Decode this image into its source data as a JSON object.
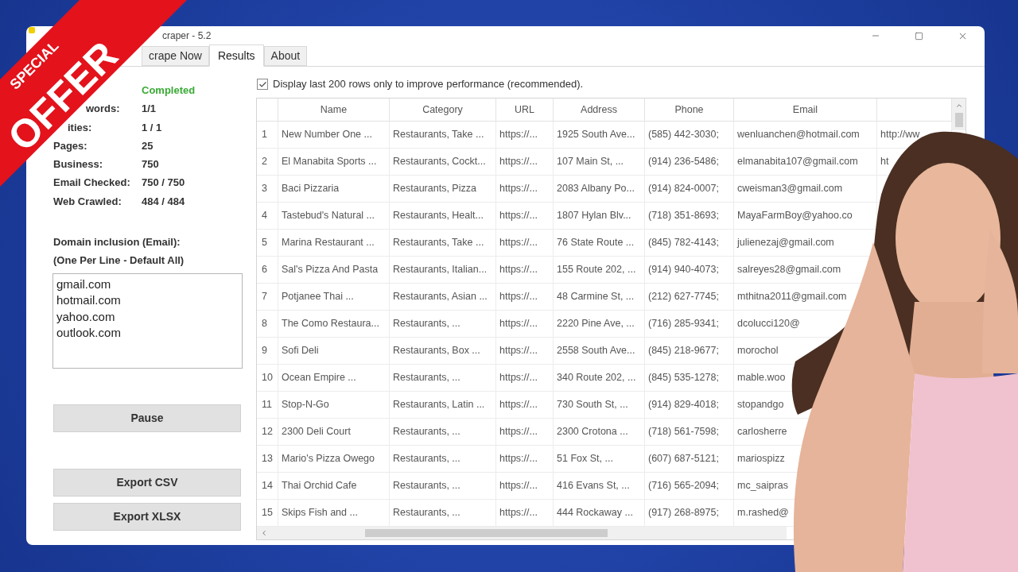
{
  "ribbon": {
    "lines": [
      {
        "text": "SPECIAL",
        "kind": "small"
      },
      {
        "text": "OFFER",
        "kind": "large"
      }
    ]
  },
  "window": {
    "title": "craper - 5.2"
  },
  "tabs": [
    {
      "label": "crape Now",
      "selected": false
    },
    {
      "label": "Results",
      "selected": true
    },
    {
      "label": "About",
      "selected": false
    }
  ],
  "stats": [
    {
      "kind": "status",
      "value": "Completed"
    },
    {
      "kind": "count",
      "label": "words:",
      "value": "1/1"
    },
    {
      "kind": "count",
      "label": "ities:",
      "value": "1 / 1"
    },
    {
      "kind": "count",
      "label": "Pages:",
      "value": "25"
    },
    {
      "kind": "count",
      "label": "Business:",
      "value": "750"
    },
    {
      "kind": "count",
      "label": "Email Checked:",
      "value": "750 / 750"
    },
    {
      "kind": "count",
      "label": "Web Crawled:",
      "value": "484 / 484"
    }
  ],
  "domain_inclusion": {
    "label": "Domain inclusion (Email):",
    "note": "(One Per Line - Default All)",
    "value": [
      "gmail.com",
      "hotmail.com",
      "yahoo.com",
      "outlook.com"
    ]
  },
  "control_buttons": [
    "Pause"
  ],
  "export_buttons": [
    "Export CSV",
    "Export XLSX"
  ],
  "display_option": {
    "label": "Display last 200 rows only to improve performance (recommended).",
    "checked": true
  },
  "table": {
    "columns": [
      "Name",
      "Category",
      "URL",
      "Address",
      "Phone",
      "Email"
    ],
    "rows": [
      {
        "number": "1",
        "cells": [
          "New Number One ...",
          "Restaurants, Take ...",
          "https://...",
          "1925 South Ave...",
          "(585) 442-3030;",
          "wenluanchen@hotmail.com",
          "http://ww"
        ]
      },
      {
        "number": "2",
        "cells": [
          "El Manabita Sports ...",
          "Restaurants, Cockt...",
          "https://...",
          "107 Main St, ...",
          "(914) 236-5486;",
          "elmanabita107@gmail.com",
          "ht"
        ]
      },
      {
        "number": "3",
        "cells": [
          "Baci Pizzaria",
          "Restaurants, Pizza",
          "https://...",
          "2083 Albany Po...",
          "(914) 824-0007;",
          "cweisman3@gmail.com"
        ]
      },
      {
        "number": "4",
        "cells": [
          "Tastebud's Natural ...",
          "Restaurants, Healt...",
          "https://...",
          "1807 Hylan Blv...",
          "(718) 351-8693;",
          "MayaFarmBoy@yahoo.co"
        ]
      },
      {
        "number": "5",
        "cells": [
          "Marina Restaurant ...",
          "Restaurants, Take ...",
          "https://...",
          "76 State Route ...",
          "(845) 782-4143;",
          "julienezaj@gmail.com"
        ]
      },
      {
        "number": "6",
        "cells": [
          "Sal's Pizza And Pasta",
          "Restaurants, Italian...",
          "https://...",
          "155 Route 202, ...",
          "(914) 940-4073;",
          "salreyes28@gmail.com"
        ]
      },
      {
        "number": "7",
        "cells": [
          "Potjanee Thai ...",
          "Restaurants, Asian ...",
          "https://...",
          "48 Carmine St, ...",
          "(212) 627-7745;",
          "mthitna2011@gmail.com"
        ]
      },
      {
        "number": "8",
        "cells": [
          "The Como Restaura...",
          "Restaurants, ...",
          "https://...",
          "2220 Pine Ave, ...",
          "(716) 285-9341;",
          "dcolucci120@"
        ]
      },
      {
        "number": "9",
        "cells": [
          "Sofi Deli",
          "Restaurants, Box ...",
          "https://...",
          "2558 South Ave...",
          "(845) 218-9677;",
          "morochol"
        ]
      },
      {
        "number": "10",
        "cells": [
          "Ocean Empire ...",
          "Restaurants, ...",
          "https://...",
          "340 Route 202, ...",
          "(845) 535-1278;",
          "mable.woo"
        ]
      },
      {
        "number": "11",
        "cells": [
          "Stop-N-Go",
          "Restaurants, Latin ...",
          "https://...",
          "730 South St, ...",
          "(914) 829-4018;",
          "stopandgo"
        ]
      },
      {
        "number": "12",
        "cells": [
          "2300 Deli Court",
          "Restaurants, ...",
          "https://...",
          "2300 Crotona ...",
          "(718) 561-7598;",
          "carlosherre"
        ]
      },
      {
        "number": "13",
        "cells": [
          "Mario's Pizza Owego",
          "Restaurants, ...",
          "https://...",
          "51 Fox St, ...",
          "(607) 687-5121;",
          "mariospizz"
        ]
      },
      {
        "number": "14",
        "cells": [
          "Thai Orchid Cafe",
          "Restaurants, ...",
          "https://...",
          "416 Evans St, ...",
          "(716) 565-2094;",
          "mc_saipras"
        ]
      },
      {
        "number": "15",
        "cells": [
          "Skips Fish and ...",
          "Restaurants, ...",
          "https://...",
          "444 Rockaway ...",
          "(917) 268-8975;",
          "m.rashed@"
        ]
      }
    ]
  }
}
